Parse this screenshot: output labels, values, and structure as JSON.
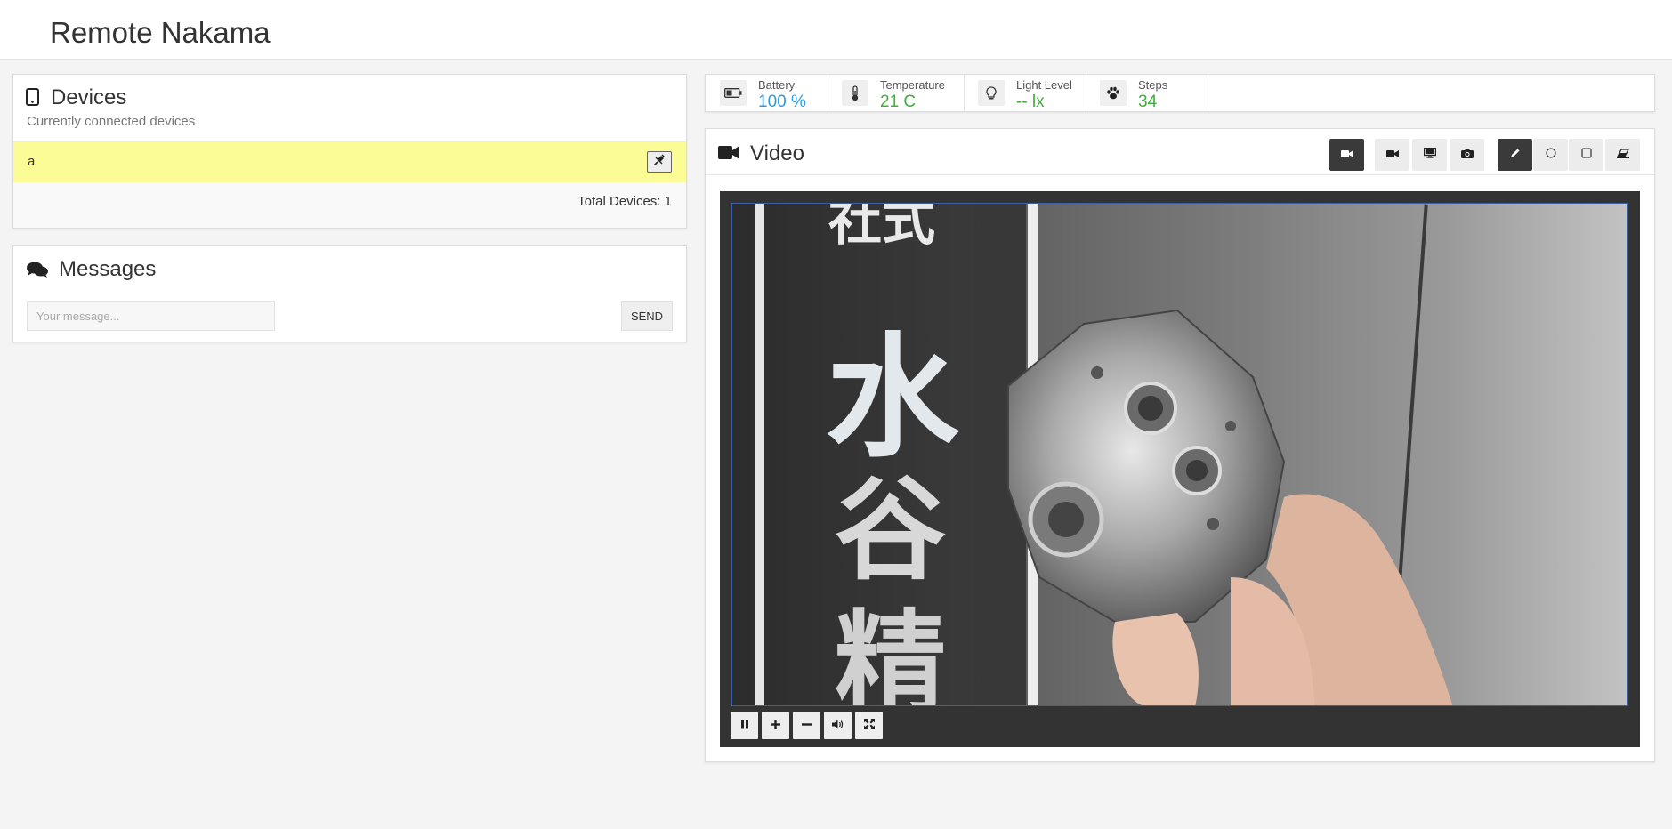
{
  "app": {
    "title": "Remote Nakama"
  },
  "devices": {
    "title": "Devices",
    "subtitle": "Currently connected devices",
    "items": [
      {
        "name": "a",
        "action_icon": "plug-disconnect-icon"
      }
    ],
    "total_text": "Total Devices: 1"
  },
  "messages": {
    "title": "Messages",
    "input_placeholder": "Your message...",
    "input_value": "",
    "send_label": "SEND"
  },
  "status": [
    {
      "label": "Battery",
      "value": "100 %",
      "icon": "battery-icon",
      "color": "#2d9ae0"
    },
    {
      "label": "Temperature",
      "value": "21 C",
      "icon": "thermometer-icon",
      "color": "#3fae3a"
    },
    {
      "label": "Light Level",
      "value": "-- lx",
      "icon": "lightbulb-icon",
      "color": "#3fae3a"
    },
    {
      "label": "Steps",
      "value": "34",
      "icon": "paw-icon",
      "color": "#3fae3a"
    }
  ],
  "video": {
    "title": "Video",
    "toolbar": [
      {
        "name": "video-toggle",
        "icon": "video-camera-icon",
        "active": true
      },
      {
        "name": "camera-source",
        "icon": "video-camera-icon",
        "active": false
      },
      {
        "name": "screen-share",
        "icon": "monitor-icon",
        "active": false
      },
      {
        "name": "snapshot",
        "icon": "camera-icon",
        "active": false
      },
      {
        "name": "pen-tool",
        "icon": "pencil-icon",
        "active": true
      },
      {
        "name": "circle-tool",
        "icon": "circle-icon",
        "active": false
      },
      {
        "name": "rectangle-tool",
        "icon": "square-icon",
        "active": false
      },
      {
        "name": "eraser-tool",
        "icon": "eraser-icon",
        "active": false
      }
    ],
    "overlay_text": [
      "社式",
      "水",
      "谷",
      "精"
    ],
    "controls": [
      "pause-icon",
      "zoom-in-icon",
      "zoom-out-icon",
      "volume-icon",
      "fullscreen-icon"
    ]
  },
  "colors": {
    "highlight_row": "#fcfc97",
    "accent_blue": "#2d9ae0",
    "accent_green": "#3fae3a",
    "active_button": "#3a3a3a"
  }
}
